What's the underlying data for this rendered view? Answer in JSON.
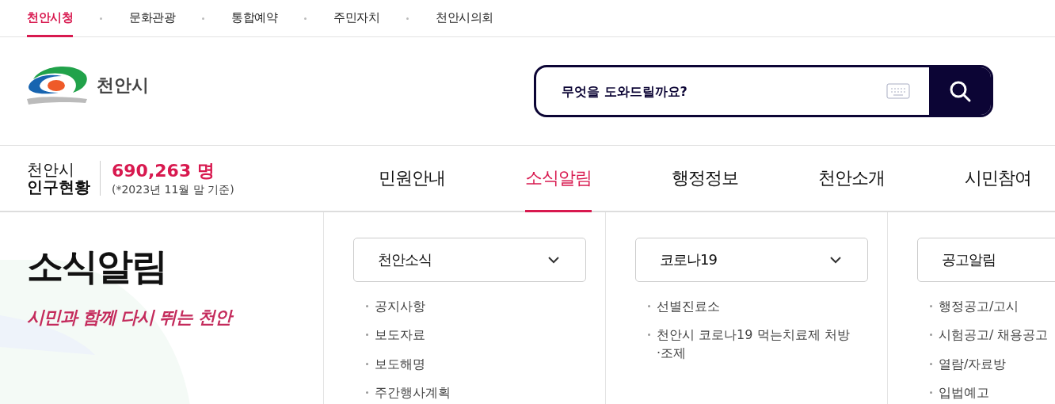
{
  "top_links": [
    {
      "label": "천안시청",
      "selected": true
    },
    {
      "label": "문화관광",
      "selected": false
    },
    {
      "label": "통합예약",
      "selected": false
    },
    {
      "label": "주민자치",
      "selected": false
    },
    {
      "label": "천안시의회",
      "selected": false
    }
  ],
  "logo": {
    "name": "천안시"
  },
  "search": {
    "placeholder": "무엇을 도와드릴까요?"
  },
  "population": {
    "label_top": "천안시",
    "label_bottom": "인구현황",
    "count": "690,263 명",
    "note": "(*2023년 11월 말 기준)"
  },
  "main_menu": [
    {
      "label": "민원안내",
      "selected": false
    },
    {
      "label": "소식알림",
      "selected": true
    },
    {
      "label": "행정정보",
      "selected": false
    },
    {
      "label": "천안소개",
      "selected": false
    },
    {
      "label": "시민참여",
      "selected": false
    }
  ],
  "section": {
    "title": "소식알림",
    "slogan": "시민과 함께 다시 뛰는 천안"
  },
  "columns": [
    {
      "heading": "천안소식",
      "items": [
        "공지사항",
        "보도자료",
        "보도해명",
        "주간행사계획"
      ]
    },
    {
      "heading": "코로나19",
      "items": [
        "선별진료소",
        "천안시 코로나19 먹는치료제 처방 ·조제"
      ]
    },
    {
      "heading": "공고알림",
      "items": [
        "행정공고/고시",
        "시험공고/ 채용공고",
        "열람/자료방",
        "입법예고"
      ]
    }
  ]
}
